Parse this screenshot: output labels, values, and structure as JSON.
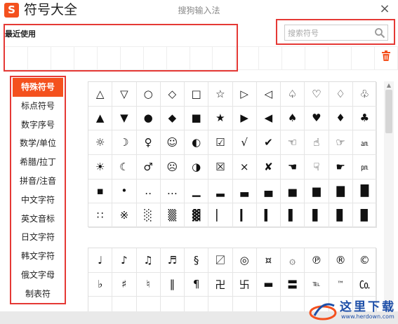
{
  "app": {
    "title": "符号大全",
    "logo_letter": "S",
    "window_caption": "搜狗输入法",
    "close_glyph": "×"
  },
  "recent": {
    "label": "最近使用"
  },
  "search": {
    "placeholder": "搜索符号",
    "value": ""
  },
  "categories": [
    {
      "label": "特殊符号",
      "active": true
    },
    {
      "label": "标点符号"
    },
    {
      "label": "数字序号"
    },
    {
      "label": "数学/单位"
    },
    {
      "label": "希腊/拉丁"
    },
    {
      "label": "拼音/注音"
    },
    {
      "label": "中文字符"
    },
    {
      "label": "英文音标"
    },
    {
      "label": "日文字符"
    },
    {
      "label": "韩文字符"
    },
    {
      "label": "俄文字母"
    },
    {
      "label": "制表符"
    }
  ],
  "symbols_top": [
    "△",
    "▽",
    "○",
    "◇",
    "□",
    "☆",
    "▷",
    "◁",
    "♤",
    "♡",
    "♢",
    "♧",
    "▲",
    "▼",
    "●",
    "◆",
    "■",
    "★",
    "▶",
    "◀",
    "♠",
    "♥",
    "♦",
    "♣",
    "☼",
    "☽",
    "♀",
    "☺",
    "◐",
    "☑",
    "√",
    "✔",
    "☜",
    "☝",
    "☞",
    "㏂",
    "☀",
    "☾",
    "♂",
    "☹",
    "◑",
    "☒",
    "×",
    "✘",
    "☚",
    "☟",
    "☛",
    "㏘",
    "▪",
    "•",
    "‥",
    "…",
    "▁",
    "▂",
    "▃",
    "▄",
    "▅",
    "▆",
    "▇",
    "█",
    "∷",
    "※",
    "░",
    "▒",
    "▓",
    "▏",
    "▎",
    "▍",
    "▌",
    "▋",
    "▊",
    "▉"
  ],
  "symbols_bottom": [
    "♩",
    "♪",
    "♫",
    "♬",
    "§",
    "〼",
    "◎",
    "¤",
    "۞",
    "℗",
    "®",
    "©",
    "♭",
    "♯",
    "♮",
    "‖",
    "¶",
    "卍",
    "卐",
    "▬",
    "〓",
    "℡",
    "™",
    "㏇",
    "",
    "",
    "",
    "",
    "",
    "",
    "",
    "",
    "",
    "",
    "",
    ""
  ],
  "watermark": {
    "text": "这里下载",
    "url": "www.herdown.com"
  },
  "colors": {
    "accent": "#f4511e",
    "highlight_border": "#e53935"
  }
}
